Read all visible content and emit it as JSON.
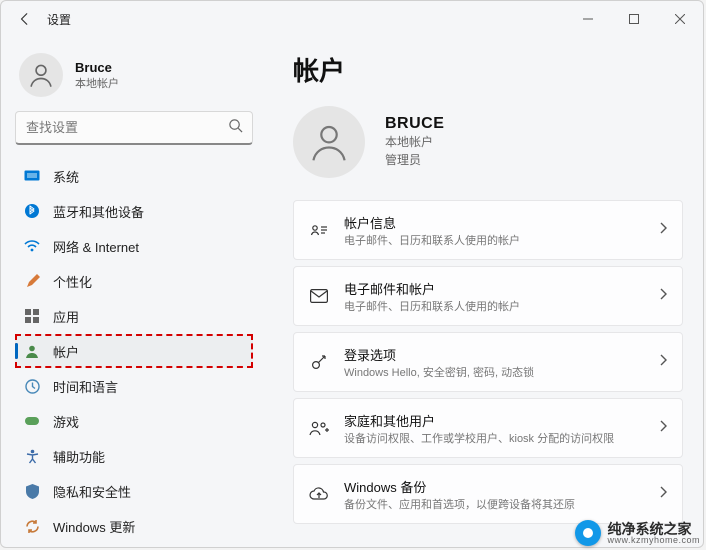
{
  "window": {
    "title": "设置"
  },
  "sidebar": {
    "user": {
      "name": "Bruce",
      "sub": "本地帐户"
    },
    "search_placeholder": "查找设置",
    "items": [
      {
        "id": "system",
        "label": "系统"
      },
      {
        "id": "bluetooth",
        "label": "蓝牙和其他设备"
      },
      {
        "id": "network",
        "label": "网络 & Internet"
      },
      {
        "id": "personalization",
        "label": "个性化"
      },
      {
        "id": "apps",
        "label": "应用"
      },
      {
        "id": "accounts",
        "label": "帐户"
      },
      {
        "id": "time",
        "label": "时间和语言"
      },
      {
        "id": "gaming",
        "label": "游戏"
      },
      {
        "id": "accessibility",
        "label": "辅助功能"
      },
      {
        "id": "privacy",
        "label": "隐私和安全性"
      },
      {
        "id": "update",
        "label": "Windows 更新"
      }
    ]
  },
  "main": {
    "title": "帐户",
    "hero": {
      "name": "BRUCE",
      "sub1": "本地帐户",
      "sub2": "管理员"
    },
    "cards": [
      {
        "title": "帐户信息",
        "desc": "电子邮件、日历和联系人使用的帐户"
      },
      {
        "title": "电子邮件和帐户",
        "desc": "电子邮件、日历和联系人使用的帐户"
      },
      {
        "title": "登录选项",
        "desc": "Windows Hello, 安全密钥, 密码, 动态锁"
      },
      {
        "title": "家庭和其他用户",
        "desc": "设备访问权限、工作或学校用户、kiosk 分配的访问权限"
      },
      {
        "title": "Windows 备份",
        "desc": "备份文件、应用和首选项，以便跨设备将其还原"
      }
    ]
  },
  "watermark": {
    "cn": "纯净系统之家",
    "url": "www.kzmyhome.com"
  }
}
